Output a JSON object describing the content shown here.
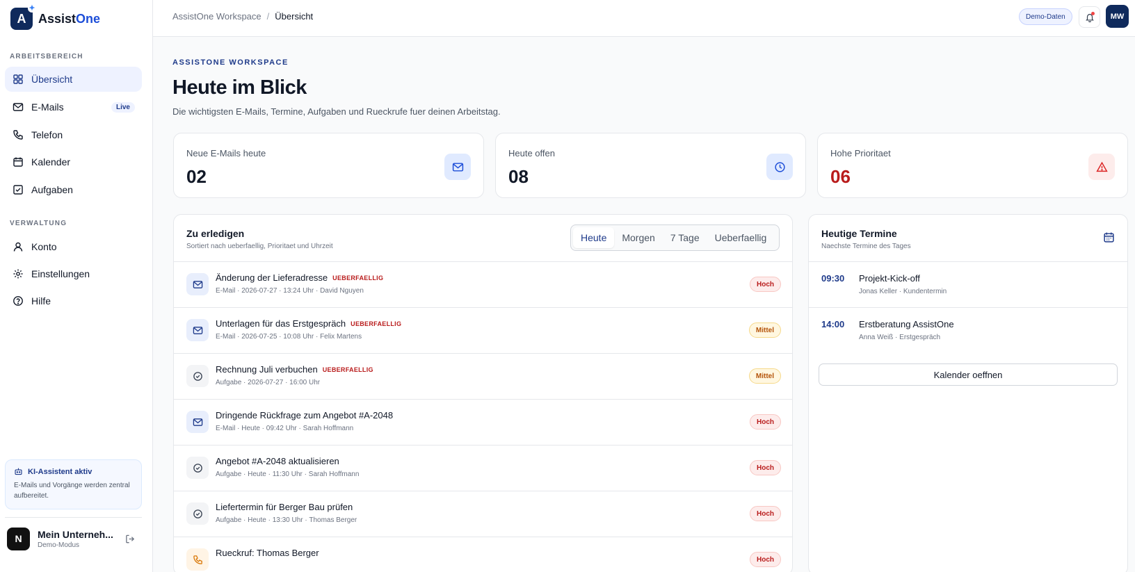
{
  "brand": {
    "logo_letter": "A",
    "name_part1": "Assist",
    "name_part2": "One"
  },
  "sidebar": {
    "section_work": "ARBEITSBEREICH",
    "section_admin": "VERWALTUNG",
    "items": [
      {
        "label": "Übersicht",
        "icon": "grid-icon"
      },
      {
        "label": "E-Mails",
        "icon": "mail-icon",
        "badge": "Live"
      },
      {
        "label": "Telefon",
        "icon": "phone-icon"
      },
      {
        "label": "Kalender",
        "icon": "calendar-icon"
      },
      {
        "label": "Aufgaben",
        "icon": "checkbox-icon"
      },
      {
        "label": "Konto",
        "icon": "user-icon"
      },
      {
        "label": "Einstellungen",
        "icon": "gear-icon"
      },
      {
        "label": "Hilfe",
        "icon": "help-icon"
      }
    ],
    "ai": {
      "title": "KI-Assistent aktiv",
      "text": "E-Mails und Vorgänge werden zentral aufbereitet."
    },
    "user": {
      "avatar": "N",
      "name": "Mein Unterneh...",
      "sub": "Demo-Modus"
    }
  },
  "topbar": {
    "breadcrumb_root": "AssistOne Workspace",
    "breadcrumb_sep": "/",
    "breadcrumb_current": "Übersicht",
    "demo_label": "Demo-Daten",
    "avatar": "MW"
  },
  "header": {
    "eyebrow": "ASSISTONE WORKSPACE",
    "title": "Heute im Blick",
    "subtitle": "Die wichtigsten E-Mails, Termine, Aufgaben und Rueckrufe fuer deinen Arbeitstag."
  },
  "stats": [
    {
      "label": "Neue E-Mails heute",
      "value": "02",
      "icon": "mail-icon"
    },
    {
      "label": "Heute offen",
      "value": "08",
      "icon": "clock-icon"
    },
    {
      "label": "Hohe Prioritaet",
      "value": "06",
      "icon": "warning-icon"
    }
  ],
  "tasks": {
    "title": "Zu erledigen",
    "subtitle": "Sortiert nach ueberfaellig, Prioritaet und Uhrzeit",
    "tabs": [
      "Heute",
      "Morgen",
      "7 Tage",
      "Ueberfaellig"
    ],
    "active_tab": "Heute",
    "overdue_label": "UEBERFAELLIG",
    "items": [
      {
        "title": "Änderung der Lieferadresse",
        "overdue": true,
        "meta": "E-Mail · 2026-07-27 · 13:24 Uhr · David Nguyen",
        "priority": "Hoch",
        "icon": "mail-icon"
      },
      {
        "title": "Unterlagen für das Erstgespräch",
        "overdue": true,
        "meta": "E-Mail · 2026-07-25 · 10:08 Uhr · Felix Martens",
        "priority": "Mittel",
        "icon": "mail-icon"
      },
      {
        "title": "Rechnung Juli verbuchen",
        "overdue": true,
        "meta": "Aufgabe · 2026-07-27 · 16:00 Uhr",
        "priority": "Mittel",
        "icon": "check-circle-icon"
      },
      {
        "title": "Dringende Rückfrage zum Angebot #A-2048",
        "overdue": false,
        "meta": "E-Mail · Heute · 09:42 Uhr · Sarah Hoffmann",
        "priority": "Hoch",
        "icon": "mail-icon"
      },
      {
        "title": "Angebot #A-2048 aktualisieren",
        "overdue": false,
        "meta": "Aufgabe · Heute · 11:30 Uhr · Sarah Hoffmann",
        "priority": "Hoch",
        "icon": "check-circle-icon"
      },
      {
        "title": "Liefertermin für Berger Bau prüfen",
        "overdue": false,
        "meta": "Aufgabe · Heute · 13:30 Uhr · Thomas Berger",
        "priority": "Hoch",
        "icon": "check-circle-icon"
      },
      {
        "title": "Rueckruf: Thomas Berger",
        "overdue": false,
        "meta": "",
        "priority": "Hoch",
        "icon": "phone-icon"
      }
    ]
  },
  "appointments": {
    "title": "Heutige Termine",
    "subtitle": "Naechste Termine des Tages",
    "items": [
      {
        "time": "09:30",
        "title": "Projekt-Kick-off",
        "meta": "Jonas Keller · Kundentermin"
      },
      {
        "time": "14:00",
        "title": "Erstberatung AssistOne",
        "meta": "Anna Weiß · Erstgespräch"
      }
    ],
    "button_label": "Kalender oeffnen"
  }
}
